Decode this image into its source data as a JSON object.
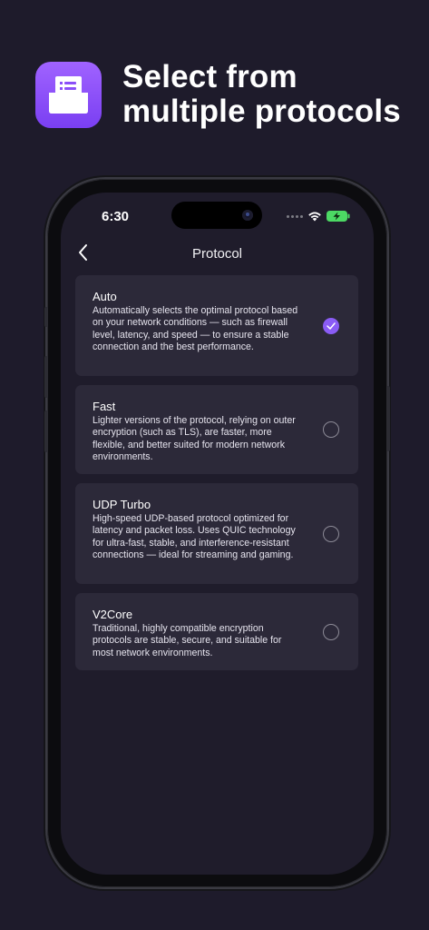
{
  "promo": {
    "icon": "mail-inbox-icon",
    "headline_line1": "Select from",
    "headline_line2": "multiple protocols"
  },
  "status_bar": {
    "time": "6:30",
    "icons": [
      "signal-dots-icon",
      "wifi-icon",
      "battery-charging-icon"
    ],
    "battery_color": "#4cd964"
  },
  "nav": {
    "back_icon": "chevron-left-icon",
    "title": "Protocol"
  },
  "protocols": [
    {
      "name": "Auto",
      "description": "Automatically selects the optimal protocol based on your network conditions — such as firewall level, latency, and speed — to ensure a stable connection and the best performance.",
      "selected": true
    },
    {
      "name": "Fast",
      "description": "Lighter versions of the protocol, relying on outer encryption (such as TLS), are faster, more flexible, and better suited for modern network environments.",
      "selected": false
    },
    {
      "name": "UDP Turbo",
      "description": "High-speed UDP-based protocol optimized for latency and packet loss. Uses QUIC technology for ultra-fast, stable, and interference-resistant connections — ideal for streaming and gaming.",
      "selected": false
    },
    {
      "name": "V2Core",
      "description": "Traditional, highly compatible encryption protocols are stable, secure, and suitable for most network environments.",
      "selected": false
    }
  ],
  "colors": {
    "background": "#1e1b2b",
    "card": "#2c2939",
    "accent": "#8a5cf5"
  }
}
